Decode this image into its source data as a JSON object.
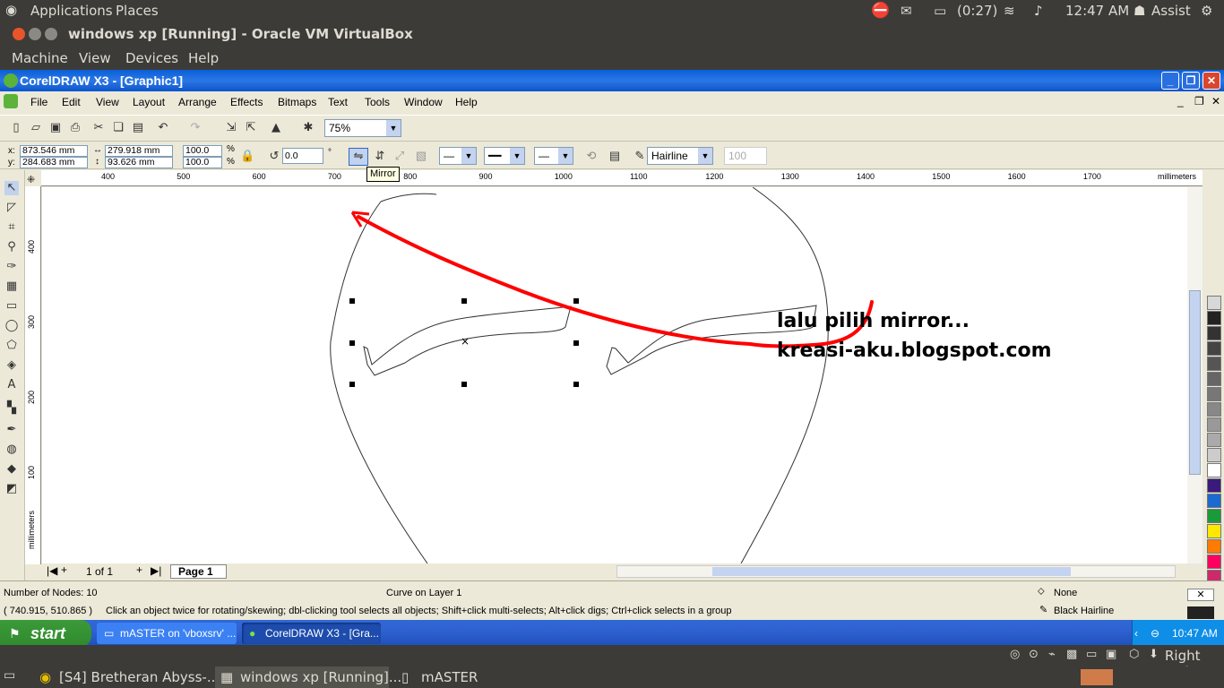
{
  "top_panel": {
    "applications": "Applications",
    "places": "Places",
    "battery": "(0:27)",
    "clock": "12:47 AM",
    "user": "Assist"
  },
  "vbox": {
    "title": "windows xp [Running] - Oracle VM VirtualBox",
    "menu": [
      "Machine",
      "View",
      "Devices",
      "Help"
    ],
    "status_right": "Right Ctrl"
  },
  "coreldraw": {
    "title": "CorelDRAW X3 - [Graphic1]",
    "menu": [
      "File",
      "Edit",
      "View",
      "Layout",
      "Arrange",
      "Effects",
      "Bitmaps",
      "Text",
      "Tools",
      "Window",
      "Help"
    ],
    "zoom": "75%",
    "prop": {
      "x": "873.546 mm",
      "y": "284.683 mm",
      "w": "279.918 mm",
      "h": "93.626 mm",
      "sx": "100.0",
      "sy": "100.0",
      "pct1": "%",
      "pct2": "%",
      "angle": "0.0",
      "deg": "°",
      "outline": "Hairline",
      "outline_pct": "100",
      "x_label": "x:",
      "y_label": "y:"
    },
    "tooltip": "Mirror",
    "ruler_unit": "millimeters",
    "ruler_h_ticks": [
      "400",
      "500",
      "600",
      "700",
      "800",
      "900",
      "1000",
      "1100",
      "1200",
      "1300",
      "1400",
      "1500",
      "1600",
      "1700"
    ],
    "ruler_v_ticks": [
      "400",
      "300",
      "200",
      "100"
    ],
    "ruler_v_unit": "millimeters",
    "annotation": {
      "line1": "lalu pilih mirror...",
      "line2": "kreasi-aku.blogspot.com",
      "color": "#ff0000"
    },
    "page_count": "1 of 1",
    "page_tab": "Page 1",
    "status": {
      "nodes": "Number of Nodes: 10",
      "layer": "Curve on Layer 1",
      "coords": "( 740.915, 510.865 )",
      "hint": "Click an object twice for rotating/skewing; dbl-clicking tool selects all objects; Shift+click multi-selects; Alt+click digs; Ctrl+click selects in a group",
      "fill": "None",
      "outline": "Black  Hairline"
    },
    "palette": [
      "#d8d8d8",
      "#222222",
      "#333333",
      "#444444",
      "#555555",
      "#666666",
      "#777777",
      "#888888",
      "#999999",
      "#aaaaaa",
      "#cccccc",
      "#ffffff",
      "#3a1a7a",
      "#1a6ad0",
      "#1a9a3a",
      "#ffe800",
      "#ff7a00",
      "#ff0060",
      "#cc2a6a",
      "#ff9a9a",
      "#ff9040",
      "#7a6a60"
    ]
  },
  "xp_taskbar": {
    "start": "start",
    "tasks": [
      "mASTER on 'vboxsrv' ...",
      "CorelDRAW X3 - [Gra..."
    ],
    "clock": "10:47 AM"
  },
  "bottom_panel": {
    "tasks": [
      "[S4] Bretheran Abyss-...",
      "windows xp [Running]...",
      "mASTER"
    ]
  }
}
